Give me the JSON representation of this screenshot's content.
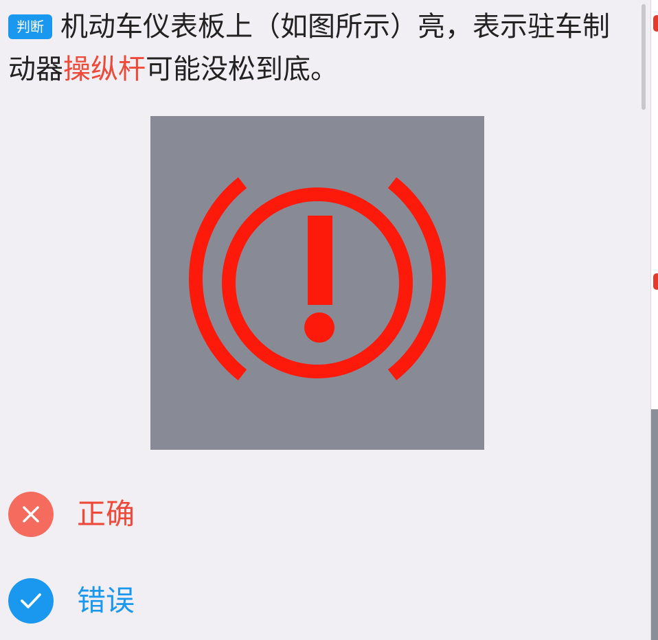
{
  "question": {
    "type_badge": "判断",
    "text_before": "机动车仪表板上（如图所示）亮，表示驻车制动器",
    "keyword": "操纵杆",
    "text_after": "可能没松到底。"
  },
  "figure": {
    "icon": "parking-brake-warning-icon",
    "background_color": "#888a95",
    "symbol_color": "#fe1a0a"
  },
  "options": [
    {
      "label": "正确",
      "icon": "close-icon",
      "color": "#f56c5f"
    },
    {
      "label": "错误",
      "icon": "check-icon",
      "color": "#1a98ef"
    }
  ],
  "colors": {
    "accent_blue": "#1a98ef",
    "highlight_red": "#ee4a3a",
    "page_background": "#f1eff3"
  }
}
